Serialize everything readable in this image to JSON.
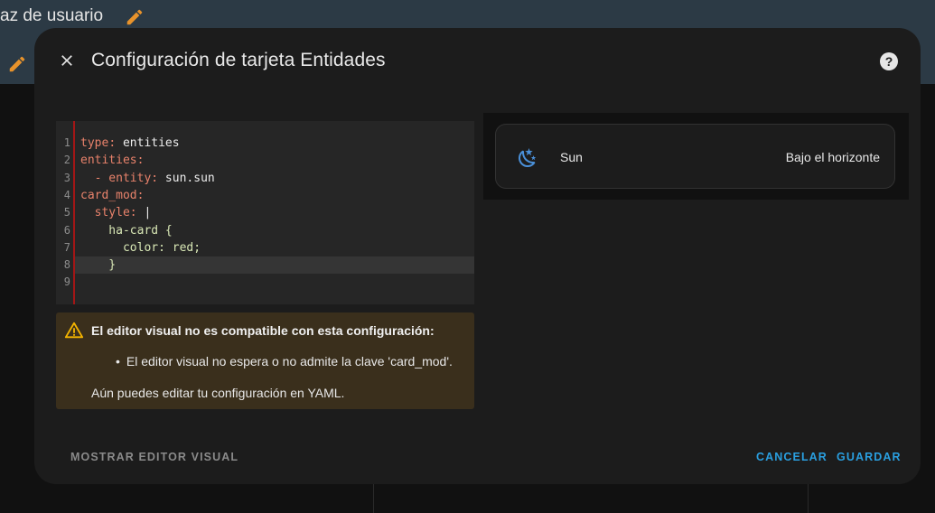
{
  "background": {
    "title": "az de usuario",
    "accent": "#e8932b"
  },
  "dialog": {
    "title": "Configuración de tarjeta Entidades",
    "close_icon": "close-icon",
    "help_icon": "help-circle-icon"
  },
  "editor": {
    "lines": [
      {
        "num": "1",
        "key": "type",
        "rest": " entities"
      },
      {
        "num": "2",
        "key": "entities",
        "rest": ""
      },
      {
        "num": "3",
        "key": "  - entity",
        "rest": " sun.sun"
      },
      {
        "num": "4",
        "key": "card_mod",
        "rest": ""
      },
      {
        "num": "5",
        "key": "  style",
        "rest": " |"
      },
      {
        "num": "6",
        "key": "",
        "rest": "    ha-card {"
      },
      {
        "num": "7",
        "key": "",
        "rest": "      color: red;"
      },
      {
        "num": "8",
        "key": "",
        "rest": "    }"
      },
      {
        "num": "9",
        "key": "",
        "rest": ""
      }
    ]
  },
  "warning": {
    "title": "El editor visual no es compatible con esta configuración:",
    "bullet": "El editor visual no espera o no admite la clave 'card_mod'.",
    "footer": "Aún puedes editar tu configuración en YAML."
  },
  "preview": {
    "entity_name": "Sun",
    "entity_state": "Bajo el horizonte",
    "icon": "weather-night-icon"
  },
  "buttons": {
    "show_visual": "MOSTRAR EDITOR VISUAL",
    "cancel": "CANCELAR",
    "save": "GUARDAR"
  },
  "colors": {
    "primary": "#2a9fe0",
    "warning_bg": "#3a2f1c",
    "warning_icon": "#f4b400",
    "gutter_rule": "#a31616"
  }
}
